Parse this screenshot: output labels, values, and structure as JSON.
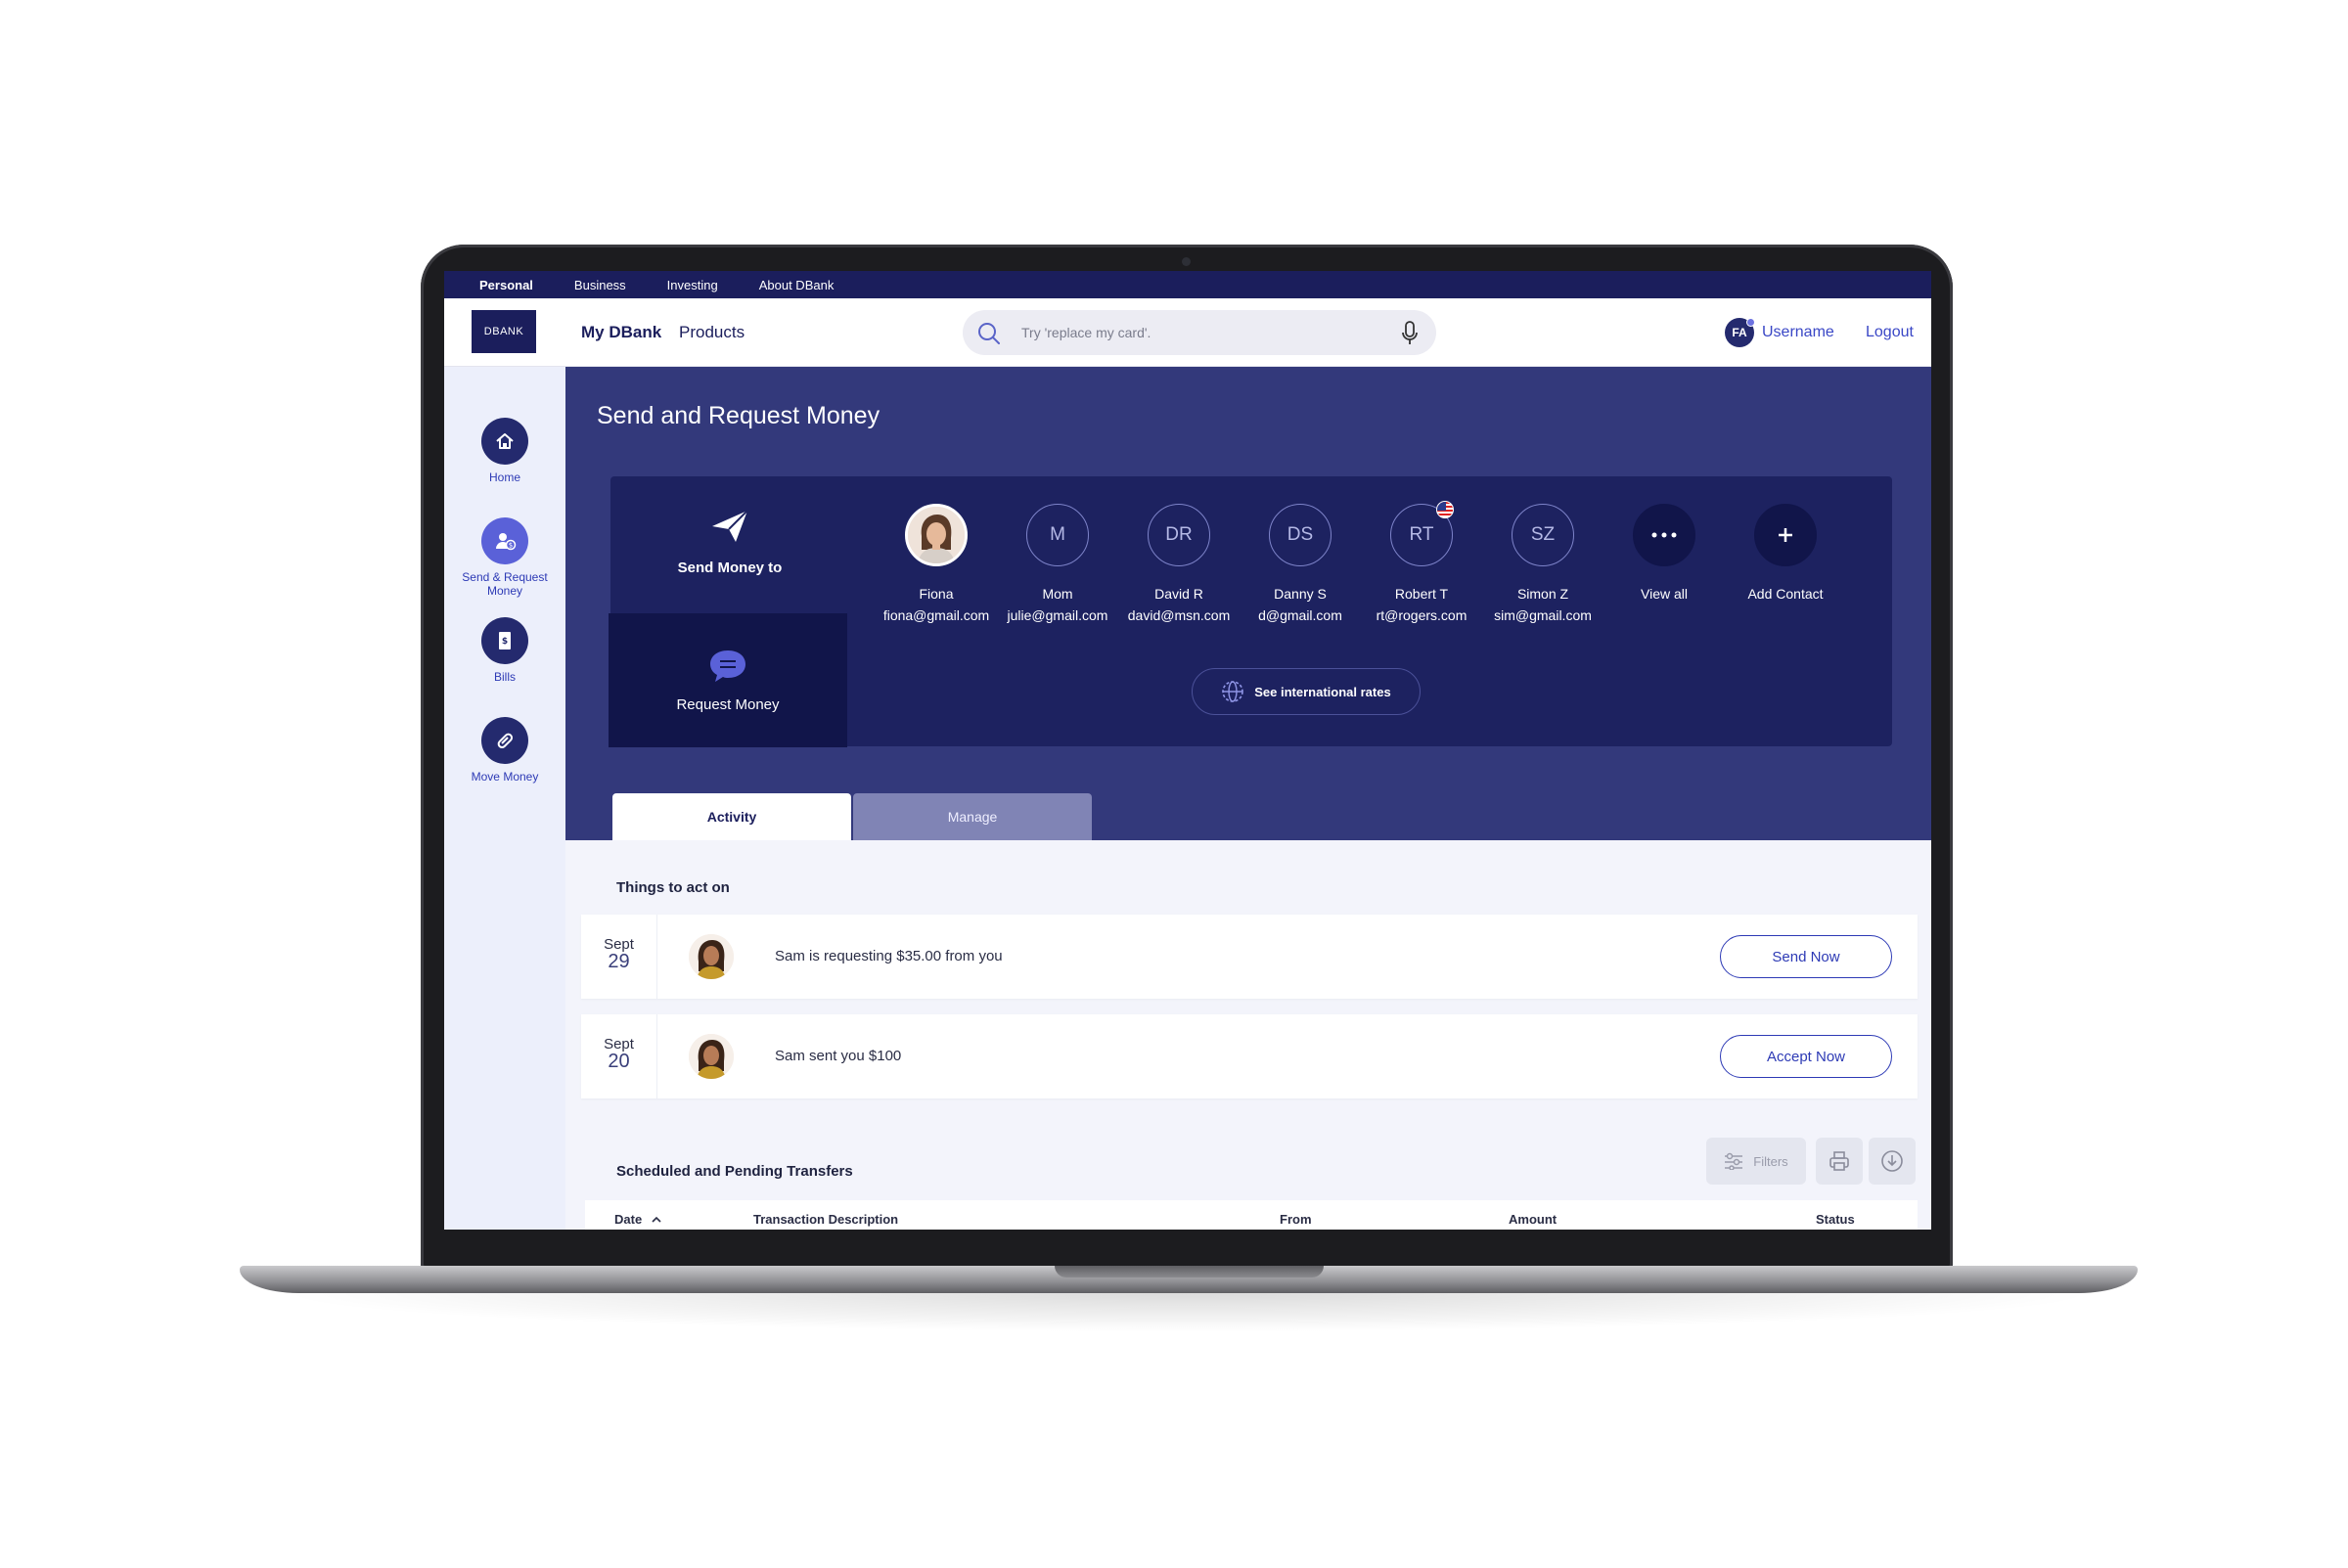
{
  "topnav": {
    "items": [
      "Personal",
      "Business",
      "Investing",
      "About DBank"
    ]
  },
  "header": {
    "logo": "DBANK",
    "my_dbank": "My DBank",
    "products": "Products",
    "search_placeholder": "Try 'replace my card'.",
    "user_initials": "FA",
    "username": "Username",
    "logout": "Logout"
  },
  "sidebar": {
    "items": [
      {
        "label": "Home",
        "icon": "home-icon"
      },
      {
        "label": "Send & Request Money",
        "icon": "send-request-icon"
      },
      {
        "label": "Bills",
        "icon": "bill-icon"
      },
      {
        "label": "Move Money",
        "icon": "move-money-icon"
      }
    ]
  },
  "hero": {
    "title": "Send and Request Money",
    "send_to_label": "Send Money to",
    "request_label": "Request Money",
    "intl_label": "See international rates",
    "contacts": [
      {
        "initials": "",
        "name": "Fiona",
        "email": "fiona@gmail.com"
      },
      {
        "initials": "M",
        "name": "Mom",
        "email": "julie@gmail.com"
      },
      {
        "initials": "DR",
        "name": "David R",
        "email": "david@msn.com"
      },
      {
        "initials": "DS",
        "name": "Danny S",
        "email": "d@gmail.com"
      },
      {
        "initials": "RT",
        "name": "Robert T",
        "email": "rt@rogers.com"
      },
      {
        "initials": "SZ",
        "name": "Simon Z",
        "email": "sim@gmail.com"
      }
    ],
    "view_all": "View all",
    "add_contact": "Add Contact",
    "tabs": [
      "Activity",
      "Manage"
    ]
  },
  "things_to_act_on": {
    "title": "Things to act on",
    "rows": [
      {
        "month": "Sept",
        "day": "29",
        "message": "Sam is requesting $35.00 from you",
        "action": "Send Now"
      },
      {
        "month": "Sept",
        "day": "20",
        "message": "Sam sent you $100",
        "action": "Accept Now"
      }
    ]
  },
  "transfers": {
    "title": "Scheduled and Pending Transfers",
    "filters_label": "Filters",
    "columns": [
      "Date",
      "Transaction Description",
      "From",
      "Amount",
      "Status"
    ]
  },
  "colors": {
    "navy": "#1b1e5c",
    "hero_bg": "#33397b",
    "panel_bg": "#1d2260",
    "accent_blue": "#2d3ab5"
  }
}
